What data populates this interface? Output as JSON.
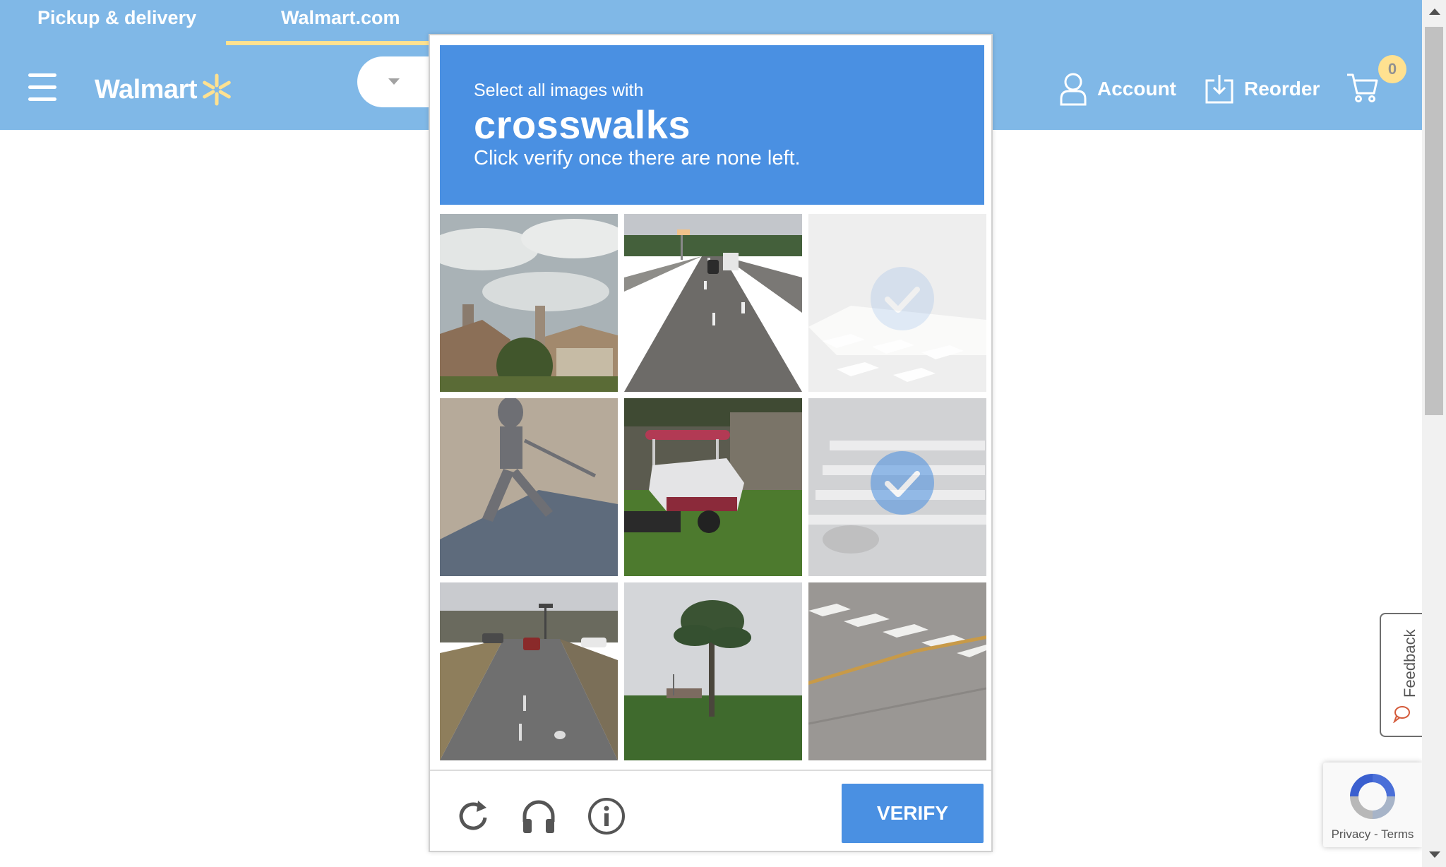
{
  "topnav": {
    "tabs": [
      {
        "label": "Pickup & delivery"
      },
      {
        "label": "Walmart.com",
        "active": true
      }
    ]
  },
  "header": {
    "logo_text": "Walmart",
    "account_label": "Account",
    "reorder_label": "Reorder",
    "cart_count": "0"
  },
  "captcha": {
    "instruction_line1": "Select all images with",
    "target": "crosswalks",
    "instruction_line3": "Click verify once there are none left.",
    "tiles": [
      {
        "content": "houses-sky",
        "selected": false
      },
      {
        "content": "highway-cars",
        "selected": false
      },
      {
        "content": "crosswalk",
        "selected": true
      },
      {
        "content": "shadow-pavement",
        "selected": false
      },
      {
        "content": "boat-trailer",
        "selected": false
      },
      {
        "content": "crosswalk",
        "selected": true
      },
      {
        "content": "road-traffic",
        "selected": false
      },
      {
        "content": "palm-tree",
        "selected": false
      },
      {
        "content": "crosswalk-road",
        "selected": false
      }
    ],
    "footer_icons": [
      "reload-icon",
      "audio-icon",
      "info-icon"
    ],
    "verify_label": "VERIFY"
  },
  "feedback": {
    "label": "Feedback"
  },
  "recaptcha_badge": {
    "privacy": "Privacy",
    "separator": "-",
    "terms": "Terms"
  },
  "colors": {
    "walmart_blue": "#0071ce",
    "walmart_yellow": "#ffc220",
    "captcha_blue": "#4a90e2"
  }
}
